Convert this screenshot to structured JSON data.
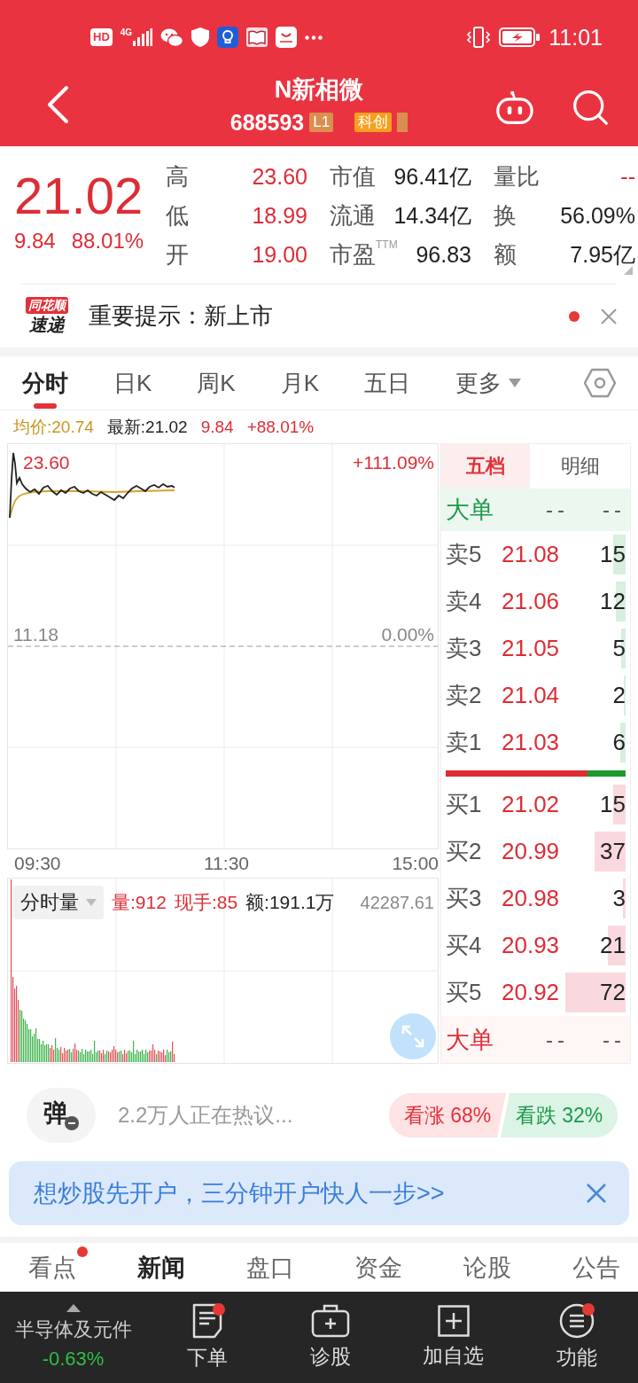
{
  "status_bar": {
    "hd": "HD",
    "network": "4G",
    "time": "11:01"
  },
  "header": {
    "title": "N新相微",
    "code": "688593",
    "tags": [
      {
        "kind": "level",
        "text": "L1"
      },
      {
        "kind": "board",
        "text": "科创"
      },
      {
        "kind": "cut"
      }
    ]
  },
  "quote": {
    "rising": true,
    "price": "21.02",
    "change": "9.84",
    "change_pct": "88.01%",
    "stat_rows": [
      [
        {
          "label": "高",
          "value": "23.60",
          "rising": true
        },
        {
          "label": "市值",
          "value": "96.41亿",
          "rising": false
        },
        {
          "label": "量比",
          "value": "--",
          "rising": true
        }
      ],
      [
        {
          "label": "低",
          "value": "18.99",
          "rising": true
        },
        {
          "label": "流通",
          "value": "14.34亿",
          "rising": false
        },
        {
          "label": "换",
          "value": "56.09%",
          "rising": false
        }
      ],
      [
        {
          "label": "开",
          "value": "19.00",
          "rising": true
        },
        {
          "label": "市盈$^{TTM}$",
          "value": "96.83",
          "rising": false
        },
        {
          "label": "额",
          "value": "7.95亿",
          "rising": false
        }
      ]
    ]
  },
  "notice": {
    "logo_top": "同花顺",
    "logo_bottom": "速递",
    "text": "重要提示：新上市",
    "unread": true
  },
  "chart_tabs": [
    {
      "label": "分时",
      "selected": true,
      "dropdown": false
    },
    {
      "label": "日K",
      "selected": false,
      "dropdown": false
    },
    {
      "label": "周K",
      "selected": false,
      "dropdown": false
    },
    {
      "label": "月K",
      "selected": false,
      "dropdown": false
    },
    {
      "label": "五日",
      "selected": false,
      "dropdown": false
    },
    {
      "label": "更多",
      "selected": false,
      "dropdown": true
    }
  ],
  "chart_info": [
    {
      "text": "均价:20.74",
      "kind": "average"
    },
    {
      "text": "最新:21.02",
      "kind": "latest"
    },
    {
      "text": "9.84",
      "kind": "change"
    },
    {
      "text": "+88.01%",
      "kind": "percent"
    }
  ],
  "price_chart": {
    "top_price": "23.60",
    "top_pct": "+111.09%",
    "base_price": "11.18",
    "base_pct": "0.00%",
    "times": [
      "09:30",
      "11:30",
      "15:00"
    ]
  },
  "volume_chart": {
    "selector": "分时量",
    "stats": [
      {
        "text": "量:912",
        "kind": "volume"
      },
      {
        "text": "现手:85",
        "kind": "last_hand"
      },
      {
        "text": "额:191.1万",
        "kind": "amount"
      }
    ],
    "axis_max": "42287.61"
  },
  "order_book": {
    "tabs": [
      {
        "label": "五档",
        "selected": true
      },
      {
        "label": "明细",
        "selected": false
      }
    ],
    "big_top": {
      "label": "大单",
      "kind": "sell",
      "values": [
        "--",
        "--"
      ]
    },
    "asks": [
      {
        "label": "卖5",
        "price": "21.08",
        "volume": "15",
        "rising": true
      },
      {
        "label": "卖4",
        "price": "21.06",
        "volume": "12",
        "rising": true
      },
      {
        "label": "卖3",
        "price": "21.05",
        "volume": "5",
        "rising": true
      },
      {
        "label": "卖2",
        "price": "21.04",
        "volume": "2",
        "rising": true
      },
      {
        "label": "卖1",
        "price": "21.03",
        "volume": "6",
        "rising": true
      }
    ],
    "buy_ratio": {
      "level": 0.79
    },
    "bids": [
      {
        "label": "买1",
        "price": "21.02",
        "volume": "15",
        "rising": true
      },
      {
        "label": "买2",
        "price": "20.99",
        "volume": "37",
        "rising": true
      },
      {
        "label": "买3",
        "price": "20.98",
        "volume": "3",
        "rising": true
      },
      {
        "label": "买4",
        "price": "20.93",
        "volume": "21",
        "rising": true
      },
      {
        "label": "买5",
        "price": "20.92",
        "volume": "72",
        "rising": true
      }
    ],
    "big_bottom": {
      "label": "大单",
      "kind": "buy",
      "values": [
        "--",
        "--"
      ]
    }
  },
  "discussion": {
    "danmaku": "弹",
    "hot_text": "2.2万人正在热议...",
    "bull": "看涨 68%",
    "bear": "看跌 32%"
  },
  "banner": {
    "text": "想炒股先开户，三分钟开户快人一步>>"
  },
  "news_tabs": [
    {
      "label": "看点",
      "selected": false,
      "badge": true
    },
    {
      "label": "新闻",
      "selected": true,
      "badge": false
    },
    {
      "label": "盘口",
      "selected": false,
      "badge": false
    },
    {
      "label": "资金",
      "selected": false,
      "badge": false
    },
    {
      "label": "论股",
      "selected": false,
      "badge": false
    },
    {
      "label": "公告",
      "selected": false,
      "badge": false
    }
  ],
  "bottom_bar": {
    "sector": "半导体及元件",
    "sector_change": "-0.63%",
    "sector_rising": false,
    "actions": [
      {
        "label": "下单",
        "kind": "order",
        "badge": true
      },
      {
        "label": "诊股",
        "kind": "diagnose",
        "badge": false
      },
      {
        "label": "加自选",
        "kind": "add",
        "badge": false
      },
      {
        "label": "功能",
        "kind": "menu",
        "badge": true
      }
    ]
  }
}
